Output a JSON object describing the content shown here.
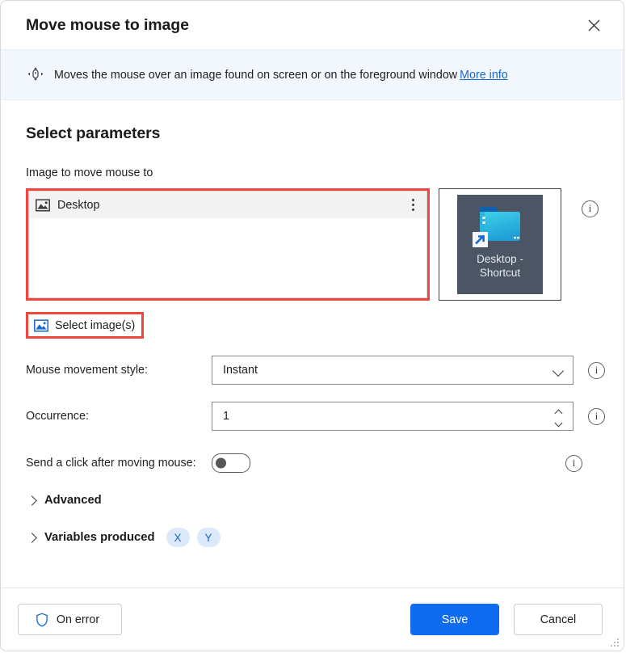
{
  "window": {
    "title": "Move mouse to image",
    "close_label": "Close"
  },
  "banner": {
    "icon": "mouse-move-icon",
    "text": "Moves the mouse over an image found on screen or on the foreground window",
    "link_label": "More info"
  },
  "main": {
    "section_title": "Select parameters",
    "image_field": {
      "label": "Image to move mouse to",
      "items": [
        {
          "name": "Desktop",
          "icon": "image-icon"
        }
      ],
      "menu_icon": "kebab-menu-icon",
      "info_icon": "info-icon",
      "select_button": {
        "label": "Select image(s)",
        "icon": "image-icon"
      },
      "preview": {
        "caption_line1": "Desktop -",
        "caption_line2": "Shortcut",
        "icon": "folder-shortcut-icon"
      }
    },
    "params": [
      {
        "label": "Mouse movement style:",
        "type": "dropdown",
        "value": "Instant",
        "chevron": "chevron-down-icon",
        "info_icon": "info-icon"
      },
      {
        "label": "Occurrence:",
        "type": "number",
        "value": "1",
        "spinner": "spinner-icon",
        "info_icon": "info-icon"
      }
    ],
    "toggle": {
      "label": "Send a click after moving mouse:",
      "state": "off",
      "info_icon": "info-icon"
    },
    "expanders": [
      {
        "label": "Advanced",
        "icon": "chevron-right-icon",
        "expanded": false
      },
      {
        "label": "Variables produced",
        "icon": "chevron-right-icon",
        "expanded": false,
        "pills": [
          "X",
          "Y"
        ]
      }
    ]
  },
  "footer": {
    "on_error_label": "On error",
    "on_error_icon": "shield-icon",
    "save_label": "Save",
    "cancel_label": "Cancel"
  },
  "colors": {
    "accent": "#0f6cf0",
    "link": "#1668d4",
    "highlight_outline": "#f2453d",
    "banner_bg": "#f2f7fd",
    "pill_bg": "#dce9fb",
    "thumbnail_bg": "#4b5563"
  }
}
